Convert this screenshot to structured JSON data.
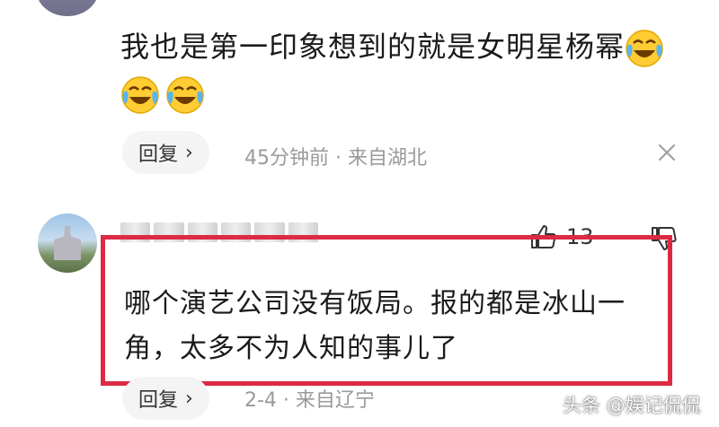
{
  "comment1": {
    "text": "我也是第一印象想到的就是女明星杨幂",
    "emojis": [
      "crying-laughing-emoji",
      "crying-laughing-emoji",
      "crying-laughing-emoji"
    ],
    "reply_label": "回复",
    "meta": "45分钟前 · 来自湖北"
  },
  "comment2": {
    "like_count": "13",
    "text_line1": "哪个演艺公司没有饭局。报的都是冰山一",
    "text_line2": "角，太多不为人知的事儿了",
    "reply_label": "回复",
    "meta": "2-4 · 来自辽宁"
  },
  "watermark": "头条 @娱记侃侃",
  "colors": {
    "highlight": "#dd2a43",
    "meta": "#9a9a9a",
    "reply_bg": "#f4f4f4"
  }
}
